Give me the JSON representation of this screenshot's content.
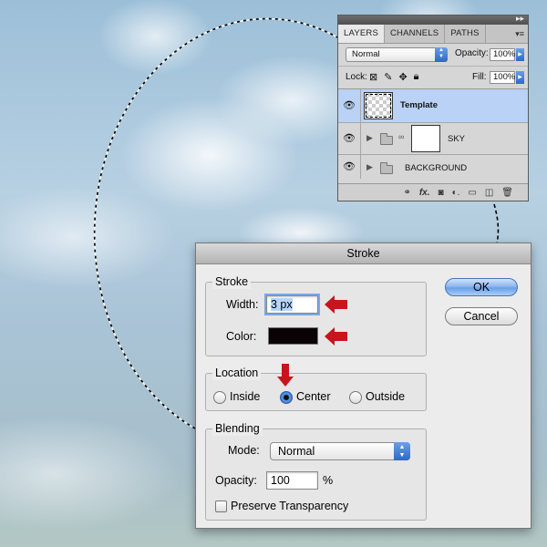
{
  "layers_panel": {
    "tabs": [
      "LAYERS",
      "CHANNELS",
      "PATHS"
    ],
    "active_tab": "LAYERS",
    "blend_mode": "Normal",
    "opacity_label": "Opacity:",
    "opacity_value": "100%",
    "lock_label": "Lock:",
    "fill_label": "Fill:",
    "fill_value": "100%",
    "layers": [
      {
        "name": "Template",
        "selected": true,
        "visible": true
      },
      {
        "name": "SKY",
        "type": "group",
        "visible": true
      },
      {
        "name": "BACKGROUND",
        "type": "group",
        "visible": true
      }
    ]
  },
  "stroke_dialog": {
    "title": "Stroke",
    "stroke_group": {
      "title": "Stroke",
      "width_label": "Width:",
      "width_value": "3 px",
      "color_label": "Color:",
      "color_value": "#0a0305"
    },
    "location_group": {
      "title": "Location",
      "options": [
        "Inside",
        "Center",
        "Outside"
      ],
      "selected": "Center"
    },
    "blending_group": {
      "title": "Blending",
      "mode_label": "Mode:",
      "mode_value": "Normal",
      "opacity_label": "Opacity:",
      "opacity_value": "100",
      "opacity_unit": "%",
      "preserve_label": "Preserve Transparency",
      "preserve_checked": false
    },
    "ok_label": "OK",
    "cancel_label": "Cancel"
  },
  "colors": {
    "annotation_arrow": "#c8141c",
    "selection_highlight": "#b9d2f5",
    "default_button": "#6aa0e6"
  }
}
